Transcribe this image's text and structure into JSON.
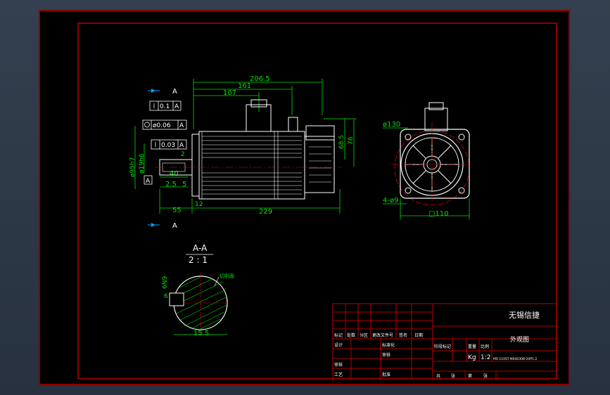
{
  "drawing": {
    "dims": {
      "d206": "206.5",
      "d161": "161",
      "d107": "107",
      "d68": "68.5",
      "d76": "76",
      "d55": "55",
      "d229": "229",
      "d12": "12",
      "d40": "40",
      "d25": "2.5",
      "d5": "5",
      "d2": "2",
      "d95": "ø95h7",
      "d19": "ø19h6",
      "d130": "ø130",
      "d110": "□110",
      "d4": "4-ø9",
      "d155": "15.5",
      "d6": "6",
      "d6n9": "6N9"
    },
    "tolerances": {
      "flat": "0.1",
      "runout": "ø0.06",
      "perp": "0.03",
      "datum": "A"
    },
    "section": {
      "label_a": "A",
      "title": "A-A",
      "scale": "2 : 1",
      "hatch_note": "切割面"
    },
    "title_block": {
      "company": "无锡信捷",
      "drawing_name": "外观图",
      "unit": "Kg",
      "scale": "1:2",
      "model_line1": "MS-110ST-M04030B-20P1.2",
      "model_line2": "",
      "h_mark": "标记",
      "h_qty": "处数",
      "h_zone": "分区",
      "h_doc": "更改文件号",
      "h_sign": "签名",
      "h_date": "日期",
      "h_design": "设计",
      "h_std": "标准化",
      "h_check": "审核",
      "h_approve": "批准",
      "h_process": "工艺",
      "h_stage": "阶段标记",
      "h_weight": "重量",
      "h_ratio": "比例",
      "h_total": "共",
      "h_sheet": "张",
      "h_page": "第"
    }
  }
}
